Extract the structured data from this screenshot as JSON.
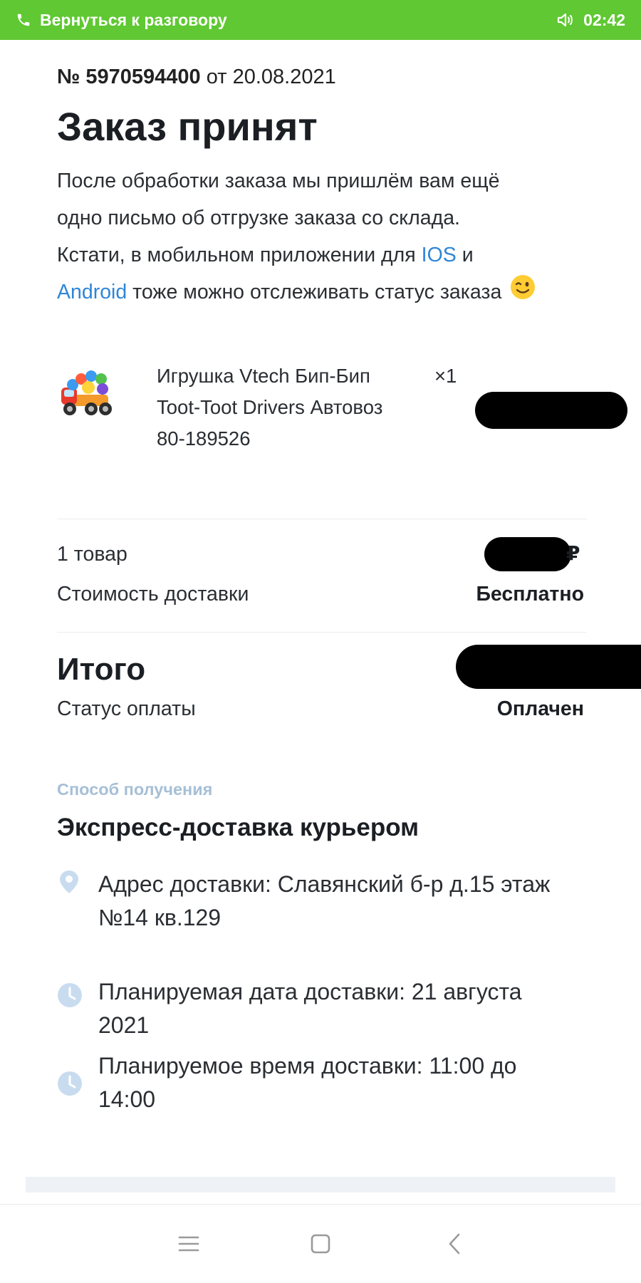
{
  "status_bar": {
    "call_return_label": "Вернуться к разговору",
    "time": "02:42",
    "bg_color": "#5fc832"
  },
  "order": {
    "number_prefix": "№",
    "number": "5970594400",
    "date_prefix": "от",
    "date": "20.08.2021",
    "title": "Заказ принят",
    "intro_line1": "После обработки заказа мы пришлём вам ещё",
    "intro_line2": "одно письмо об отгрузке заказа со склада.",
    "intro_line3_start": "Кстати, в мобильном приложении для",
    "ios_link": "IOS",
    "intro_line3_end": "и",
    "android_link": "Android",
    "intro_line4_end": "тоже можно отслеживать статус заказа",
    "emoji_name": "winking-face"
  },
  "product": {
    "name_line1": "Игрушка Vtech Бип-Бип",
    "name_line2": "Toot-Toot Drivers Автовоз",
    "code": "80-189526",
    "quantity": "×1",
    "image": "toy-truck-image"
  },
  "summary": {
    "items_label": "1 товар",
    "currency_symbol": "₽",
    "delivery_label": "Стоимость доставки",
    "delivery_value": "Бесплатно",
    "total_label": "Итого",
    "payment_status_label": "Статус оплаты",
    "payment_status_value": "Оплачен"
  },
  "delivery": {
    "section_label": "Способ получения",
    "method": "Экспресс-доставка курьером",
    "address_line1": "Адрес доставки: Славянский б-р д.15 этаж",
    "address_line2": "№14 кв.129",
    "date_line1": "Планируемая дата доставки: 21 августа",
    "date_line2": "2021",
    "time_line1": "Планируемое время доставки: 11:00 до",
    "time_line2": "14:00",
    "icon_color": "#c9dcef"
  },
  "nav": {
    "buttons": [
      "menu-icon",
      "home-icon",
      "back-icon"
    ]
  }
}
